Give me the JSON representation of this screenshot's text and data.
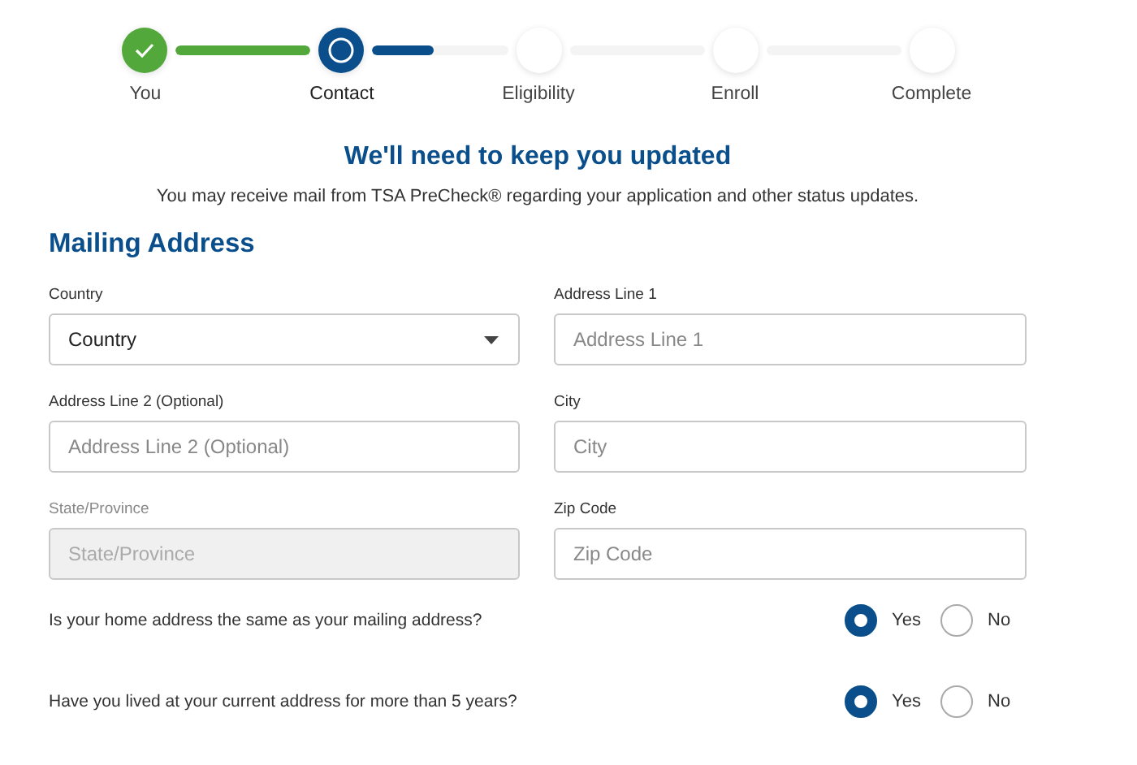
{
  "steps": [
    {
      "label": "You",
      "completed": true,
      "current": false
    },
    {
      "label": "Contact",
      "completed": false,
      "current": true
    },
    {
      "label": "Eligibility",
      "completed": false,
      "current": false
    },
    {
      "label": "Enroll",
      "completed": false,
      "current": false
    },
    {
      "label": "Complete",
      "completed": false,
      "current": false
    }
  ],
  "connectors": [
    {
      "level": 1
    },
    {
      "level": 0.45
    },
    {
      "level": 0
    },
    {
      "level": 0
    }
  ],
  "heading": "We'll need to keep you updated",
  "subheading": "You may receive mail from TSA PreCheck® regarding your application and other status updates.",
  "section_title": "Mailing Address",
  "fields": [
    {
      "label": "Country",
      "kind": "select",
      "value": "Country",
      "disabled": false
    },
    {
      "label": "Address Line 1",
      "kind": "text",
      "placeholder": "Address Line 1",
      "disabled": false
    },
    {
      "label": "Address Line 2 (Optional)",
      "kind": "text",
      "placeholder": "Address Line 2 (Optional)",
      "disabled": false
    },
    {
      "label": "City",
      "kind": "text",
      "placeholder": "City",
      "disabled": false
    },
    {
      "label": "State/Province",
      "kind": "text",
      "placeholder": "State/Province",
      "disabled": true
    },
    {
      "label": "Zip Code",
      "kind": "text",
      "placeholder": "Zip Code",
      "disabled": false
    }
  ],
  "questions": [
    {
      "text": "Is your home address the same as your mailing address?",
      "options": [
        {
          "label": "Yes",
          "selected": true
        },
        {
          "label": "No",
          "selected": false
        }
      ]
    },
    {
      "text": "Have you lived at your current address for more than 5 years?",
      "options": [
        {
          "label": "Yes",
          "selected": true
        },
        {
          "label": "No",
          "selected": false
        }
      ]
    }
  ]
}
